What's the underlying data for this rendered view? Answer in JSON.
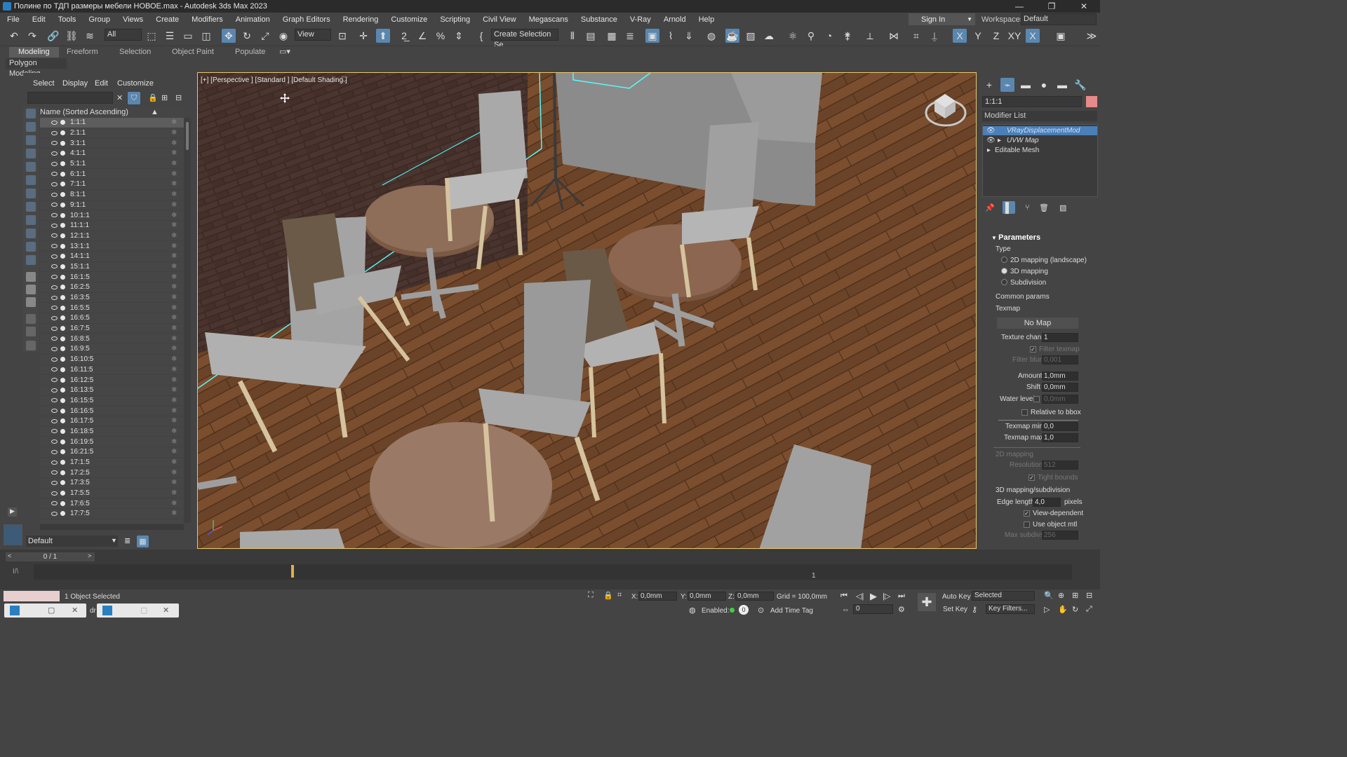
{
  "window": {
    "title": "Полине по ТДП размеры мебели НОВОЕ.max - Autodesk 3ds Max 2023",
    "minimize": "—",
    "restore": "❐",
    "close": "✕"
  },
  "menu": [
    "File",
    "Edit",
    "Tools",
    "Group",
    "Views",
    "Create",
    "Modifiers",
    "Animation",
    "Graph Editors",
    "Rendering",
    "Customize",
    "Scripting",
    "Civil View",
    "Megascans",
    "Substance",
    "V-Ray",
    "Arnold",
    "Help"
  ],
  "account": {
    "signin": "Sign In",
    "workspaces_label": "Workspaces:",
    "workspace": "Default"
  },
  "toolbar": {
    "filter": "All",
    "refcoord": "View",
    "selection_set": "Create Selection Se"
  },
  "ribbon": {
    "tabs": [
      "Modeling",
      "Freeform",
      "Selection",
      "Object Paint",
      "Populate"
    ],
    "panel": "Polygon Modeling"
  },
  "explorer": {
    "menu": [
      "Select",
      "Display",
      "Edit",
      "Customize"
    ],
    "col_name": "Name (Sorted Ascending)",
    "col_frozen": "▲ Frozen",
    "layer": "Default",
    "items": [
      "1:1:1",
      "2:1:1",
      "3:1:1",
      "4:1:1",
      "5:1:1",
      "6:1:1",
      "7:1:1",
      "8:1:1",
      "9:1:1",
      "10:1:1",
      "11:1:1",
      "12:1:1",
      "13:1:1",
      "14:1:1",
      "15:1:1",
      "16:1:5",
      "16:2:5",
      "16:3:5",
      "16:5:5",
      "16:6:5",
      "16:7:5",
      "16:8:5",
      "16:9:5",
      "16:10:5",
      "16:11:5",
      "16:12:5",
      "16:13:5",
      "16:15:5",
      "16:16:5",
      "16:17:5",
      "16:18:5",
      "16:19:5",
      "16:21:5",
      "17:1:5",
      "17:2:5",
      "17:3:5",
      "17:5:5",
      "17:6:5",
      "17:7:5"
    ]
  },
  "viewport": {
    "label": "[+] [Perspective ] [Standard ] [Default Shading ]"
  },
  "command_panel": {
    "object_name": "1:1:1",
    "modifier_list": "Modifier List",
    "stack": [
      "VRayDisplacementMod",
      "UVW Map",
      "Editable Mesh"
    ],
    "section": "Parameters",
    "type_label": "Type",
    "type_options": [
      "2D mapping (landscape)",
      "3D mapping",
      "Subdivision"
    ],
    "common": "Common params",
    "texmap": "Texmap",
    "no_map": "No Map",
    "texture_chan_label": "Texture chan",
    "texture_chan": "1",
    "filter_texmap": "Filter texmap",
    "filter_blur_label": "Filter blur",
    "filter_blur": "0,001",
    "amount_label": "Amount",
    "amount": "1,0mm",
    "shift_label": "Shift",
    "shift": "0,0mm",
    "water_label": "Water level",
    "water": "0,0mm",
    "relative": "Relative to bbox",
    "texmap_min_label": "Texmap min",
    "texmap_min": "0,0",
    "texmap_max_label": "Texmap max",
    "texmap_max": "1,0",
    "map2d": "2D mapping",
    "resolution_label": "Resolution",
    "resolution": "512",
    "tight": "Tight bounds",
    "map3d": "3D mapping/subdivision",
    "edge_label": "Edge length",
    "edge": "4,0",
    "pixels": "pixels",
    "view_dep": "View-dependent",
    "use_obj": "Use object mtl",
    "max_subdivs_label": "Max subdivs",
    "max_subdivs": "256"
  },
  "timeline": {
    "frame": "0 / 1",
    "tick": "1"
  },
  "status": {
    "selected": "1 Object Selected",
    "x_label": "X:",
    "x": "0,0mm",
    "y_label": "Y:",
    "y": "0,0mm",
    "z_label": "Z:",
    "z": "0,0mm",
    "grid": "Grid = 100,0mm",
    "enabled": "Enabled:",
    "add_time_tag": "Add Time Tag",
    "auto_key": "Auto Key",
    "set_key": "Set Key",
    "selected_dd": "Selected",
    "key_filters": "Key Filters...",
    "frame_num": "0"
  }
}
